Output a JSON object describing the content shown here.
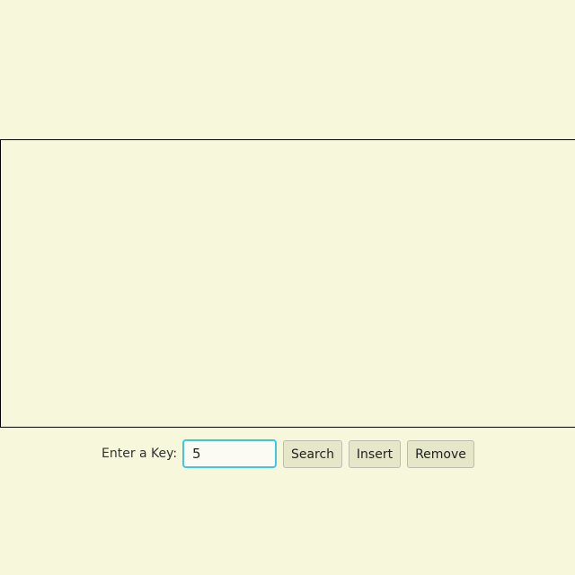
{
  "form": {
    "label": "Enter a Key:",
    "key_value": "5",
    "search": "Search",
    "insert": "Insert",
    "remove": "Remove"
  }
}
